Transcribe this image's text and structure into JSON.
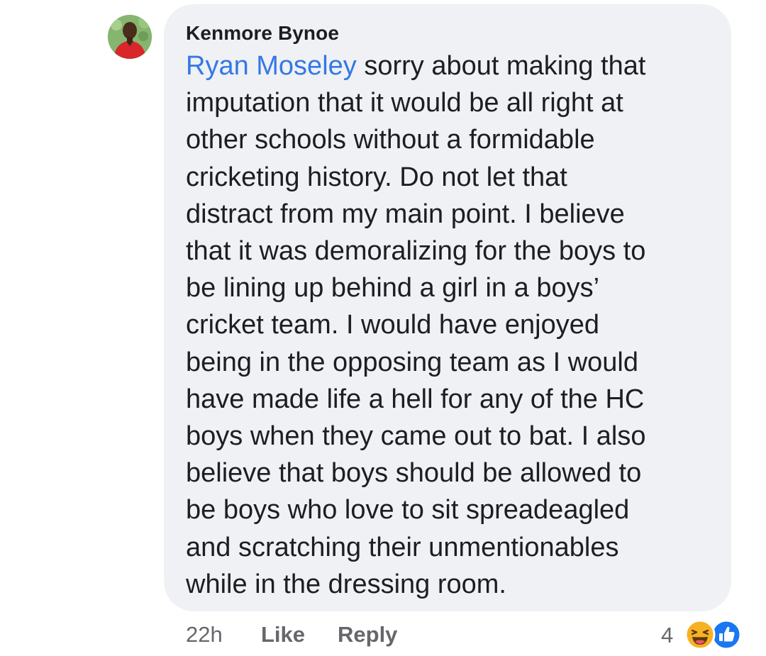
{
  "comment": {
    "author": "Kenmore Bynoe",
    "mention": "Ryan Moseley",
    "text": " sorry about making that\nimputation that it would be all right at\nother schools without a formidable\ncricketing history. Do not let that\ndistract from my main point.  I believe\nthat it was demoralizing for the boys to\nbe lining up behind a girl in a boys’\ncricket team. I would have enjoyed\nbeing in the opposing team as I would\nhave made life a hell for any of the HC\nboys when they came out to bat.  I also\nbelieve that boys should be allowed to\nbe boys who love to sit spreadeagled\nand scratching their unmentionables\nwhile in the dressing room."
  },
  "footer": {
    "time": "22h",
    "like_label": "Like",
    "reply_label": "Reply"
  },
  "reactions": {
    "count": "4",
    "icons": [
      "haha-reaction-icon",
      "like-reaction-icon"
    ]
  },
  "colors": {
    "bubble": "#eff1f4",
    "mention": "#3578e5",
    "like_reaction": "#1877f2",
    "haha_reaction": "#f7b125",
    "meta_text": "#65676b"
  }
}
